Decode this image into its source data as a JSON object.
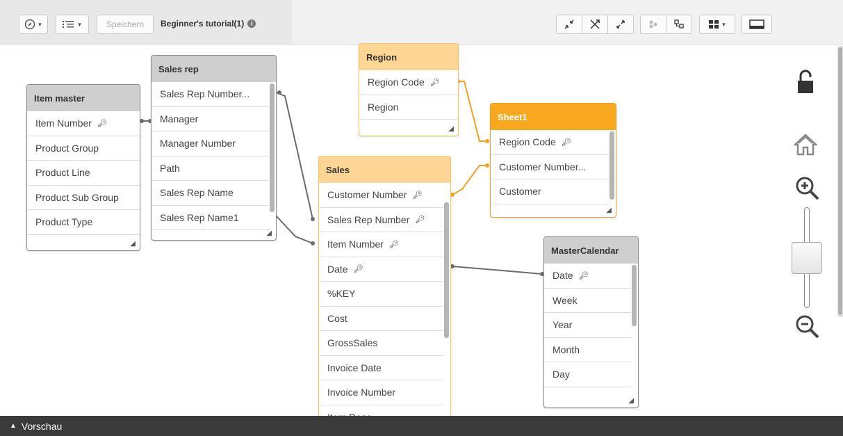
{
  "toolbar": {
    "nav_icon": "compass-icon",
    "list_icon": "list-view-icon",
    "save_label": "Speichern",
    "app_title": "Beginner's tutorial(1)",
    "info_icon": "info-icon",
    "right_icons": [
      "collapse-all-icon",
      "hide-links-icon",
      "expand-all-icon",
      "internal-view-icon",
      "source-view-icon",
      "layout-grid-icon",
      "preview-panel-icon"
    ]
  },
  "tables": {
    "item_master": {
      "title": "Item master",
      "fields": [
        "Item Number",
        "Product Group",
        "Product Line",
        "Product Sub Group",
        "Product Type"
      ],
      "key_fields": [
        0
      ]
    },
    "sales_rep": {
      "title": "Sales rep",
      "fields": [
        "Sales Rep Number...",
        "Manager",
        "Manager Number",
        "Path",
        "Sales Rep Name",
        "Sales Rep Name1"
      ],
      "key_fields": []
    },
    "region": {
      "title": "Region",
      "fields": [
        "Region Code",
        "Region"
      ],
      "key_fields": [
        0
      ]
    },
    "sheet1": {
      "title": "Sheet1",
      "fields": [
        "Region Code",
        "Customer Number...",
        "Customer"
      ],
      "key_fields": [
        0
      ]
    },
    "sales": {
      "title": "Sales",
      "fields": [
        "Customer Number",
        "Sales Rep Number",
        "Item Number",
        "Date",
        "%KEY",
        "Cost",
        "GrossSales",
        "Invoice Date",
        "Invoice Number",
        "Item Desc"
      ],
      "key_fields": [
        0,
        1,
        2,
        3
      ]
    },
    "master_calendar": {
      "title": "MasterCalendar",
      "fields": [
        "Date",
        "Week",
        "Year",
        "Month",
        "Day"
      ],
      "key_fields": [
        0
      ]
    }
  },
  "controls": [
    "lock-icon",
    "home-icon",
    "zoom-in-icon",
    "zoom-slider",
    "zoom-out-icon"
  ],
  "colors": {
    "link_gray": "#6b6b6b",
    "link_orange": "#f4a020",
    "header_gray": "#cfcfcf",
    "header_orange": "#fdd595",
    "header_selected": "#f7a81f"
  },
  "footer": {
    "label": "Vorschau",
    "icon": "triangle-up-icon"
  }
}
